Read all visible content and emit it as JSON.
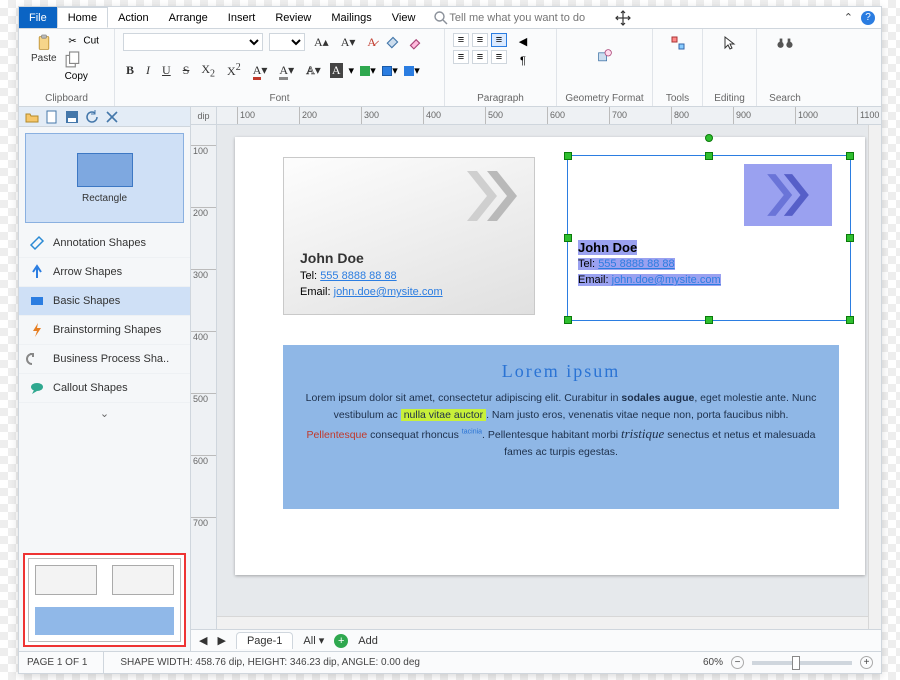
{
  "menu": {
    "file": "File",
    "tabs": [
      "Home",
      "Action",
      "Arrange",
      "Insert",
      "Review",
      "Mailings",
      "View"
    ],
    "active": "Home",
    "search_placeholder": "Tell me what you want to do"
  },
  "ribbon": {
    "clipboard": {
      "paste": "Paste",
      "cut": "Cut",
      "copy": "Copy",
      "label": "Clipboard"
    },
    "font": {
      "label": "Font"
    },
    "paragraph": {
      "label": "Paragraph"
    },
    "geometry": {
      "label": "Geometry Format"
    },
    "tools": {
      "label": "Tools"
    },
    "editing": {
      "label": "Editing"
    },
    "search": {
      "label": "Search"
    }
  },
  "sidebar": {
    "ruler_unit": "dip",
    "preview_label": "Rectangle",
    "categories": [
      {
        "icon": "annotation",
        "label": "Annotation Shapes"
      },
      {
        "icon": "arrow",
        "label": "Arrow Shapes"
      },
      {
        "icon": "basic",
        "label": "Basic Shapes"
      },
      {
        "icon": "brain",
        "label": "Brainstorming Shapes"
      },
      {
        "icon": "process",
        "label": "Business Process Sha.."
      },
      {
        "icon": "callout",
        "label": "Callout Shapes"
      }
    ],
    "selected": "Basic Shapes"
  },
  "ruler_ticks": [
    100,
    200,
    300,
    400,
    500,
    600,
    700,
    800,
    900,
    1000,
    1100
  ],
  "vruler_ticks": [
    100,
    200,
    300,
    400,
    500,
    600,
    700
  ],
  "card": {
    "name": "John Doe",
    "tel_label": "Tel:",
    "tel": "555 8888 88 88",
    "email_label": "Email:",
    "email": "john.doe@mysite.com"
  },
  "lorem": {
    "title": "Lorem ipsum",
    "body_pre": "Lorem ipsum dolor sit amet, consectetur adipiscing elit. Curabitur in ",
    "bold1": "sodales augue",
    "body_mid1": ", eget molestie ante. Nunc vestibulum ac ",
    "highlight": "nulla vitae auctor",
    "body_mid2": ". Nam justo eros, venenatis vitae neque non, porta faucibus nibh. ",
    "red": "Pellentesque",
    "body_mid3": " consequat rhoncus ",
    "sup": "tacinia",
    "body_mid4": ". Pellentesque habitant morbi ",
    "script": "tristique",
    "body_end": " senectus et netus et malesuada fames ac turpis egestas."
  },
  "pagetabs": {
    "page1": "Page-1",
    "all": "All",
    "add": "Add"
  },
  "status": {
    "page": "PAGE 1 OF 1",
    "shape": "SHAPE WIDTH: 458.76 dip, HEIGHT: 346.23 dip, ANGLE: 0.00 deg",
    "zoom": "60%"
  }
}
